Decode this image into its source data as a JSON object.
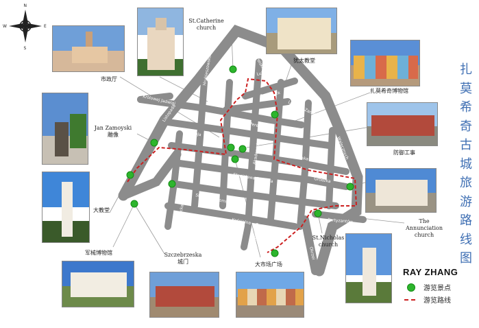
{
  "title": "扎莫希奇古城旅游路线图",
  "author": "RAY ZHANG",
  "compass": {
    "n": "N",
    "s": "S",
    "e": "E",
    "w": "W"
  },
  "legend": {
    "spot_label": "游览景点",
    "route_label": "游览路线"
  },
  "colors": {
    "road": "#8c8c8c",
    "route": "#cc1f1f",
    "spot": "#2db52d",
    "title": "#3f6fb3"
  },
  "labels": {
    "st_catherine": "St.Catherine church",
    "city_hall": "市政厅",
    "synagogue": "犹太教堂",
    "zamoyski_museum": "扎莫希奇博物馆",
    "jan_zamoyski": "Jan Zamoyski 雕像",
    "fortification": "防御工事",
    "cathedral": "大教堂",
    "annunciation": "The Annunciation church",
    "arsenal": "军械博物馆",
    "szczebrzeska": "Szczebrzeska 城门",
    "market": "大市场广场",
    "st_nicholas": "St.Nicholas church"
  },
  "streets": {
    "krolowej_jadwigi": "Królowej Jadwigi",
    "hrubieszowska": "Hrubieszowska",
    "lukasinskiego": "Lukasińskiego",
    "przyrynek": "Przyrynek",
    "zamenhofa": "Ludwika Zamenhofa",
    "peowiakow": "Izchaka Peretza",
    "akademicka": "Akademicka",
    "kollataja": "Kołłątaja",
    "ormianska": "Ormiańska",
    "staszica": "Stanisława Staszica",
    "zeromskiego": "Stefana Żeromskiego",
    "bazylianska": "Bazyliańska",
    "kolegiacka": "Kolegiacka",
    "koscielna": "Kościelna",
    "partyzantow": "Partyzantów",
    "okrzei": "Okrzei",
    "wojska_polskiego": "Wojska Polskiego",
    "grodzka": "Grodzka",
    "szczebrzeska": "Szczebrzeska",
    "waleczna": "Walecznych",
    "listopada": "Listopada"
  }
}
